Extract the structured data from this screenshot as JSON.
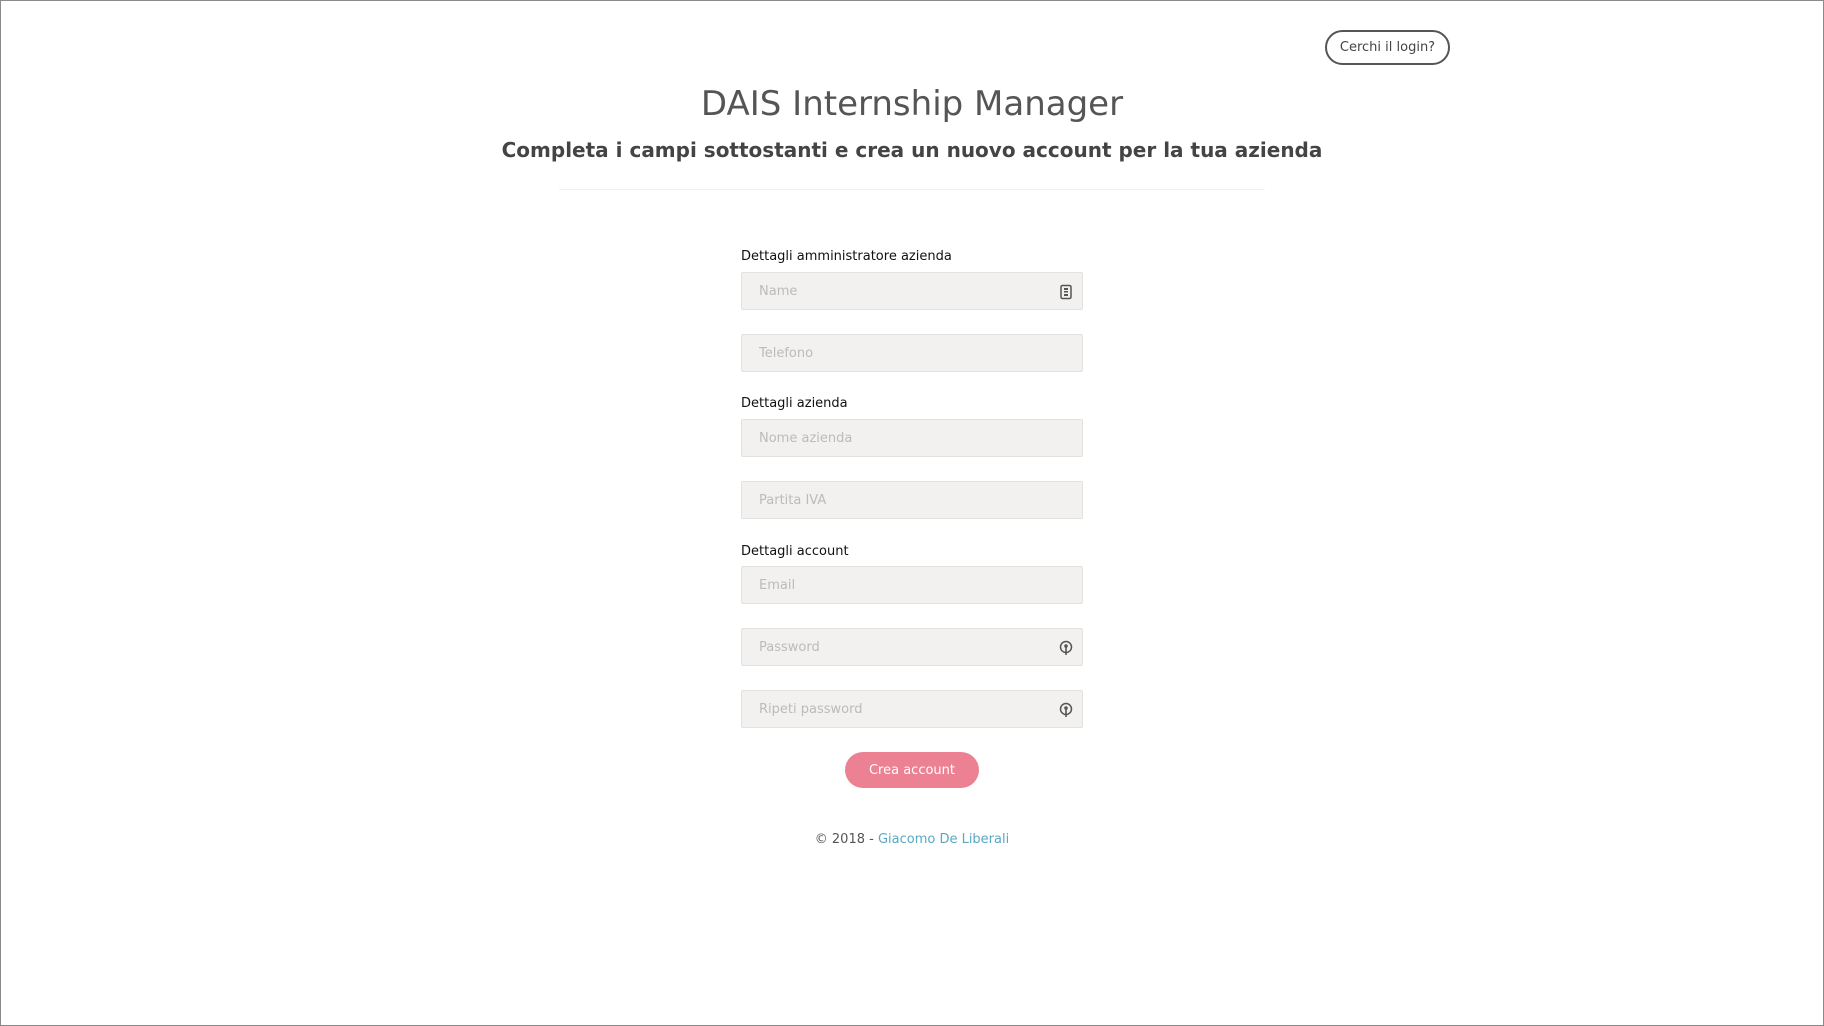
{
  "header": {
    "login_link": "Cerchi il login?",
    "title": "DAIS Internship Manager",
    "subtitle": "Completa i campi sottostanti e crea un nuovo account per la tua azienda"
  },
  "form": {
    "admin_section_label": "Dettagli amministratore azienda",
    "name_placeholder": "Name",
    "phone_placeholder": "Telefono",
    "company_section_label": "Dettagli azienda",
    "company_name_placeholder": "Nome azienda",
    "vat_placeholder": "Partita IVA",
    "account_section_label": "Dettagli account",
    "email_placeholder": "Email",
    "password_placeholder": "Password",
    "repeat_password_placeholder": "Ripeti password",
    "submit_label": "Crea account"
  },
  "icons": {
    "name_field_icon": "contact-card-icon",
    "password_field_icon": "password-manager-icon",
    "repeat_password_field_icon": "password-manager-icon"
  },
  "footer": {
    "copyright": "© 2018 - ",
    "author": "Giacomo De Liberali"
  },
  "colors": {
    "primary_button": "#ec8193",
    "link": "#5aa8c2",
    "input_background": "#f2f1ef"
  }
}
